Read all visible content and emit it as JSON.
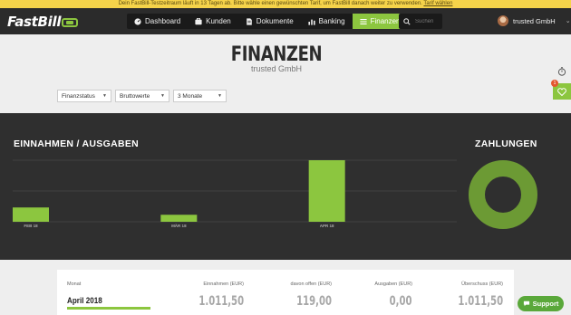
{
  "banner": {
    "text": "Dein FastBill-Testzeitraum läuft in 13 Tagen ab. Bitte wähle einen gewünschten Tarif, um FastBill danach weiter zu verwenden.",
    "link": "Tarif wählen"
  },
  "app": {
    "logo": "FastBill"
  },
  "nav": [
    {
      "label": "Dashboard",
      "icon": "dashboard-icon",
      "active": false
    },
    {
      "label": "Kunden",
      "icon": "customers-icon",
      "active": false
    },
    {
      "label": "Dokumente",
      "icon": "document-icon",
      "active": false
    },
    {
      "label": "Banking",
      "icon": "bar-chart-icon",
      "active": false
    },
    {
      "label": "Finanzen",
      "icon": "finance-icon",
      "active": true
    }
  ],
  "search": {
    "placeholder": "Suchen"
  },
  "user": {
    "name": "trusted GmbH"
  },
  "page": {
    "title": "FINANZEN",
    "subtitle": "trusted GmbH"
  },
  "filters": [
    {
      "value": "Finanzstatus"
    },
    {
      "value": "Bruttowerte"
    },
    {
      "value": "3 Monate"
    }
  ],
  "side": {
    "badge": "1"
  },
  "colors": {
    "accent": "#8cc63f",
    "dark": "#2f2f2f",
    "donut_dark": "#6c9a34"
  },
  "chart": {
    "title": "EINNAHMEN / AUSGABEN",
    "donut_title": "ZAHLUNGEN"
  },
  "chart_data": [
    {
      "type": "bar",
      "title": "EINNAHMEN / AUSGABEN",
      "categories": [
        "FEB 18",
        "MÄR 18",
        "APR 18"
      ],
      "series": [
        {
          "values": [
            235,
            115,
            1011.5
          ]
        }
      ],
      "ylim": [
        0,
        1011.5
      ],
      "grid": true
    },
    {
      "type": "pie",
      "title": "ZAHLUNGEN",
      "donut": true
    }
  ],
  "table": {
    "headers": [
      "Monat",
      "Einnahmen (EUR)",
      "davon offen (EUR)",
      "Ausgaben (EUR)",
      "Überschuss (EUR)"
    ],
    "rows": [
      {
        "month": "April 2018",
        "progress": 0.62,
        "einnahmen": "1.011,50",
        "offen": "119,00",
        "ausgaben": "0,00",
        "ueberschuss": "1.011,50"
      }
    ]
  },
  "support": {
    "label": "Support"
  }
}
